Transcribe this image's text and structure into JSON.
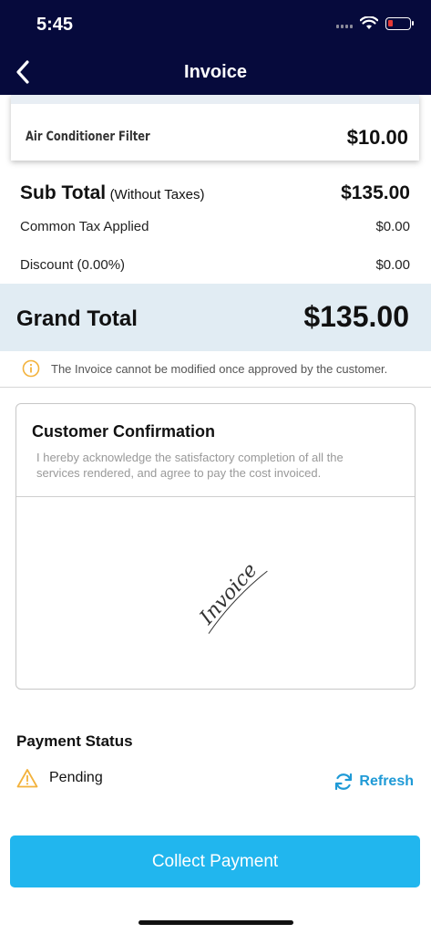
{
  "status_bar": {
    "time": "5:45"
  },
  "nav": {
    "title": "Invoice"
  },
  "line_item": {
    "name": "Air Conditioner Filter",
    "price": "$10.00"
  },
  "summary": {
    "subtotal_label": "Sub Total",
    "subtotal_note": "(Without Taxes)",
    "subtotal_value": "$135.00",
    "tax_label": "Common Tax Applied",
    "tax_value": "$0.00",
    "discount_label": "Discount (0.00%)",
    "discount_value": "$0.00"
  },
  "grand_total": {
    "label": "Grand Total",
    "value": "$135.00"
  },
  "notice": "The Invoice cannot be modified once approved by the customer.",
  "confirmation": {
    "title": "Customer Confirmation",
    "text": "I hereby acknowledge the satisfactory completion of all the services rendered, and agree to pay the cost invoiced.",
    "signature": "Invoice"
  },
  "payment": {
    "title": "Payment Status",
    "status": "Pending",
    "refresh_label": "Refresh"
  },
  "collect_button": "Collect Payment",
  "colors": {
    "nav_bg": "#060a3c",
    "accent": "#21b6ee",
    "refresh": "#1f9ad6",
    "warning": "#f3b23c",
    "grand_bg": "#e1ecf3"
  }
}
